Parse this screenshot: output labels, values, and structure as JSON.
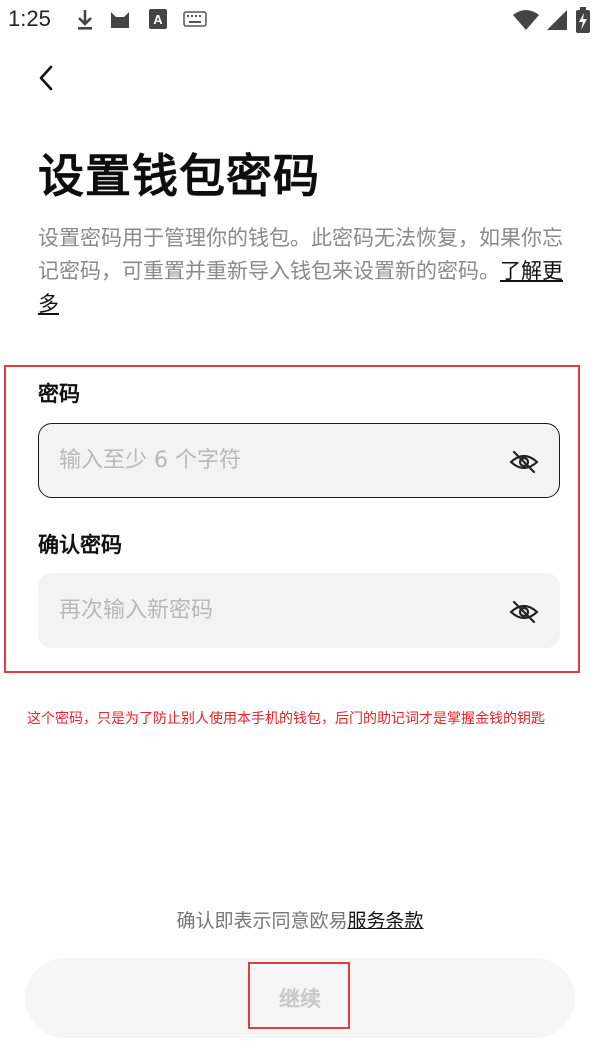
{
  "status_bar": {
    "time": "1:25"
  },
  "nav": {
    "back_icon": "chevron-left-icon"
  },
  "page": {
    "title": "设置钱包密码",
    "description": "设置密码用于管理你的钱包。此密码无法恢复，如果你忘记密码，可重置并重新导入钱包来设置新的密码。",
    "learn_more": "了解更多"
  },
  "form": {
    "password": {
      "label": "密码",
      "value": "",
      "placeholder": "输入至少 6 个字符",
      "toggle_icon": "eye-off-icon"
    },
    "confirm": {
      "label": "确认密码",
      "value": "",
      "placeholder": "再次输入新密码",
      "toggle_icon": "eye-off-icon"
    }
  },
  "annotation": {
    "note": "这个密码，只是为了防止别人使用本手机的钱包，后门的助记词才是掌握金钱的钥匙"
  },
  "footer": {
    "terms_prefix": "确认即表示同意欧易",
    "terms_link": "服务条款",
    "continue_label": "继续"
  },
  "colors": {
    "annotation_red": "#e23c3c",
    "note_red": "#e8232a",
    "disabled_text": "#c8c8c8"
  }
}
